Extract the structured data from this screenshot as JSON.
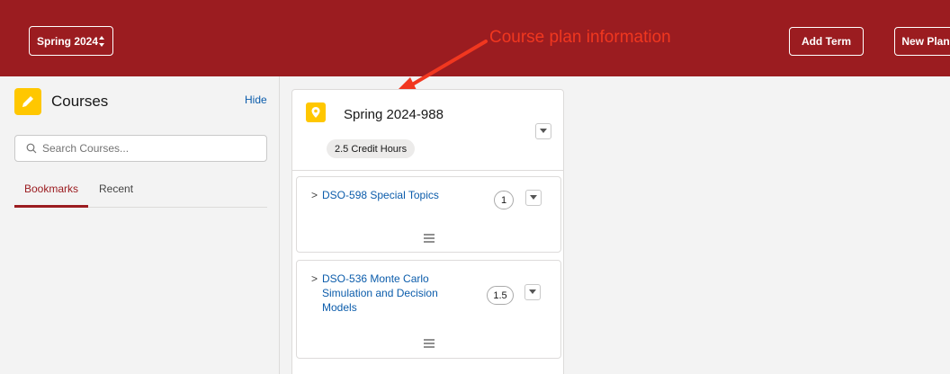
{
  "header": {
    "term_select_value": "Spring 2024",
    "annotation": "Course plan information",
    "add_term_label": "Add Term",
    "new_plan_label": "New Plan",
    "background_color": "#9b1c20",
    "annotation_color": "#f1371f"
  },
  "sidebar": {
    "title": "Courses",
    "hide_label": "Hide",
    "search_placeholder": "Search Courses...",
    "tabs": [
      {
        "label": "Bookmarks",
        "active": true
      },
      {
        "label": "Recent",
        "active": false
      }
    ],
    "icon": "pencil-icon"
  },
  "term": {
    "title": "Spring 2024-988",
    "credit_hours": "2.5 Credit Hours",
    "icon": "location-pin-icon",
    "courses": [
      {
        "name": "DSO-598 Special Topics",
        "credits": "1"
      },
      {
        "name": "DSO-536 Monte Carlo Simulation and Decision Models",
        "credits": "1.5"
      }
    ]
  }
}
